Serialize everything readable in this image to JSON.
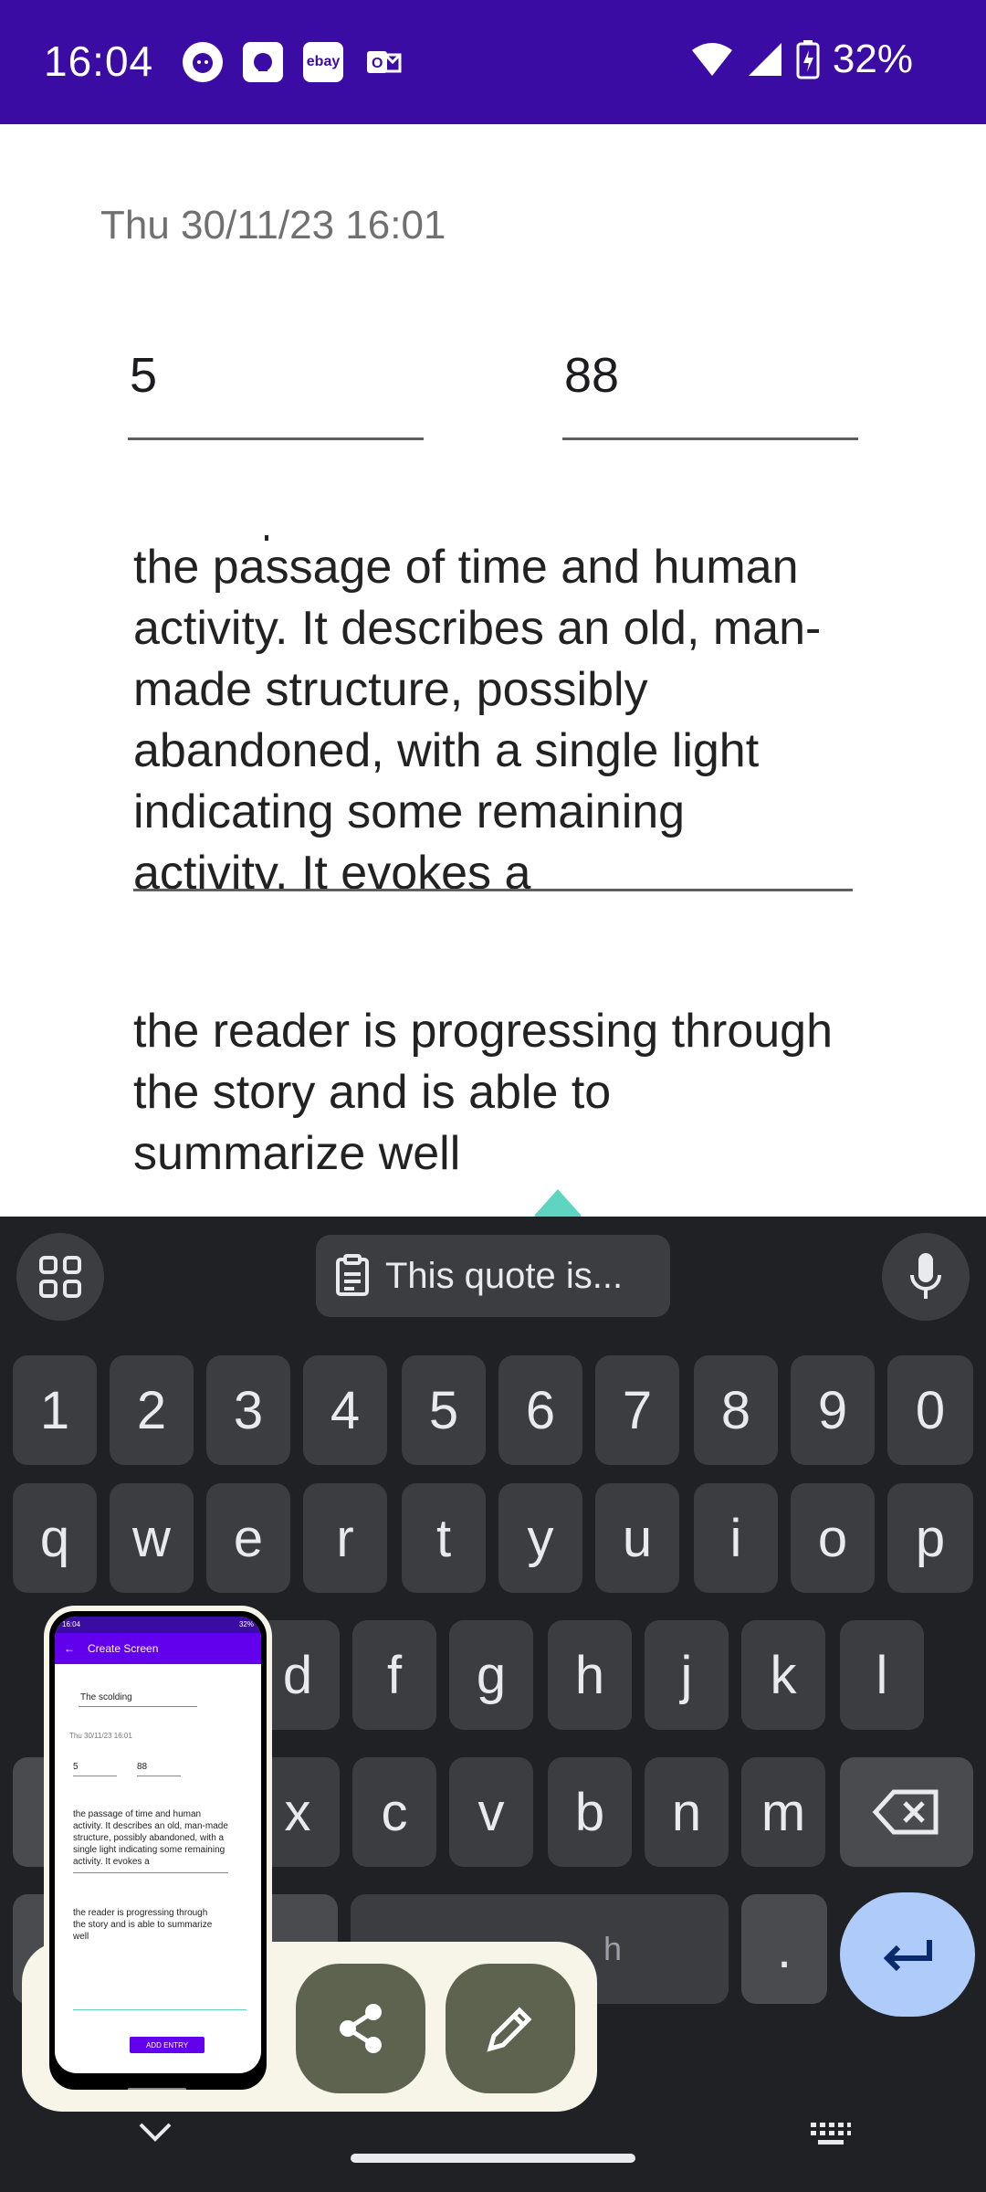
{
  "status_bar": {
    "time": "16:04",
    "battery": "32%",
    "notification_icons": [
      "cat-app-icon",
      "photo-app-icon",
      "ebay-icon",
      "outlook-icon"
    ],
    "ebay_label": "ebay"
  },
  "form": {
    "date": "Thu 30/11/23 16:01",
    "field_left_value": "5",
    "field_right_value": "88",
    "text_area_1": "the passage of time and human activity. It describes an old, man-made structure, possibly abandoned, with a single light indicating some remaining activity. It evokes a",
    "text_area_2": "the reader is progressing through the story and is able to summarize well"
  },
  "keyboard": {
    "suggestion_chip": "This quote is...",
    "number_row": [
      "1",
      "2",
      "3",
      "4",
      "5",
      "6",
      "7",
      "8",
      "9",
      "0"
    ],
    "row_q": [
      "q",
      "w",
      "e",
      "r",
      "t",
      "y",
      "u",
      "i",
      "o",
      "p"
    ],
    "row_a_visible": [
      "d",
      "f",
      "g",
      "h",
      "j",
      "k",
      "l"
    ],
    "row_z_visible": [
      "x",
      "c",
      "v",
      "b",
      "n",
      "m"
    ],
    "period_key": ".",
    "space_partial": "h"
  },
  "preview": {
    "status_time": "16:04",
    "status_battery": "32%",
    "title": "Create Screen",
    "field_title": "The scolding",
    "date": "Thu 30/11/23 16:01",
    "v1": "5",
    "v2": "88",
    "text1": "the passage of time and human activity. It describes an old, man-made structure, possibly abandoned, with a single light indicating some remaining activity. It evokes a",
    "text2": "the reader is progressing through the story and is able to summarize well",
    "button": "ADD ENTRY"
  },
  "colors": {
    "status_bar": "#3a0ca3",
    "app_bar": "#6200ee",
    "cursor_handle": "#5fd4c0",
    "keyboard_bg": "#202124",
    "key_bg": "#3c3d41",
    "enter_key": "#aecbfa",
    "overlay_card": "#f6f5e8",
    "overlay_buttons": "#5d634e"
  }
}
